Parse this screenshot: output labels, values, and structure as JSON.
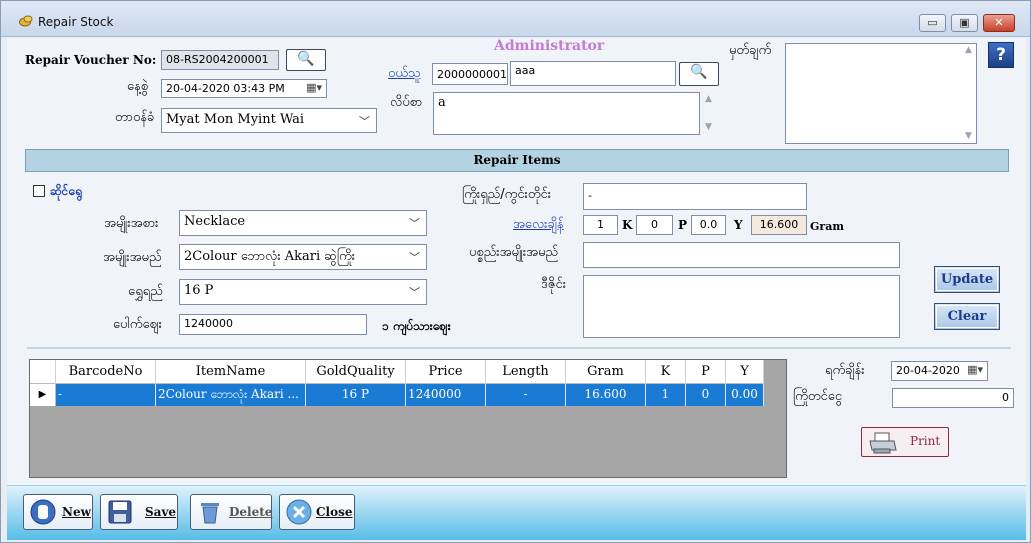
{
  "window": {
    "title": "Repair Stock",
    "minimize": "▭",
    "maximize": "▣",
    "close": "✕"
  },
  "header": {
    "admin_label": "Administrator",
    "voucher_label": "Repair Voucher No:",
    "voucher_value": "08-RS2004200001",
    "date_label": "နေ့စွဲ",
    "date_value": "20-04-2020 03:43 PM",
    "staff_label": "တာဝန်ခံ",
    "staff_value": "Myat Mon Myint Wai",
    "customer_label": "ဝယ်သူ",
    "customer_code": "2000000001",
    "customer_name": "aaa",
    "address_label": "လိပ်စာ",
    "address_value": "a",
    "remark_label": "မှတ်ချက်",
    "remark_value": "",
    "help_icon": "?"
  },
  "section": {
    "title": "Repair Items"
  },
  "item_form": {
    "own_shop_label": "ဆိုင်ရွေ",
    "category_label": "အမျိုးအစား",
    "category_value": "Necklace",
    "item_name_label": "အမျိုးအမည်",
    "item_name_value": "2Colour ဘောလုံး Akari ဆွဲကြိုး",
    "quality_label": "ရွှေရည်",
    "quality_value": "16 P",
    "price_label": "ပေါက်ဈေး",
    "price_value": "1240000",
    "price_unit": "၁ ကျပ်သားဈေး",
    "length_label": "ကြိုးရှည်/ကွင်းတိုင်း",
    "length_value": "-",
    "weight_label": "အလေးချိန်",
    "k_value": "1",
    "k_unit": "K",
    "p_value": "0",
    "p_unit": "P",
    "y_value": "0.0",
    "y_unit": "Y",
    "gram_value": "16.600",
    "gram_unit": "Gram",
    "broken_label": "ပစ္စည်းအမျိုးအမည်",
    "broken_value": "",
    "design_label": "ဒီဇိုင်း",
    "design_value": "",
    "update_label": "Update",
    "clear_label": "Clear"
  },
  "grid": {
    "columns": [
      "BarcodeNo",
      "ItemName",
      "GoldQuality",
      "Price",
      "Length",
      "Gram",
      "K",
      "P",
      "Y"
    ],
    "row_marker": "▶",
    "rows": [
      {
        "barcode": "-",
        "item": "2Colour ဘောလုံး Akari ...",
        "quality": "16 P",
        "price": "1240000",
        "length": "-",
        "gram": "16.600",
        "k": "1",
        "p": "0",
        "y": "0.00"
      }
    ]
  },
  "side": {
    "receive_date_label": "ရက်ချိန်း",
    "receive_date_value": "20-04-2020",
    "advance_label": "ကြိုတင်ငွေ",
    "advance_value": "0",
    "print_label": "Print"
  },
  "toolbar": {
    "new_label": "New",
    "save_label": "Save",
    "delete_label": "Delete",
    "close_label": "Close"
  }
}
